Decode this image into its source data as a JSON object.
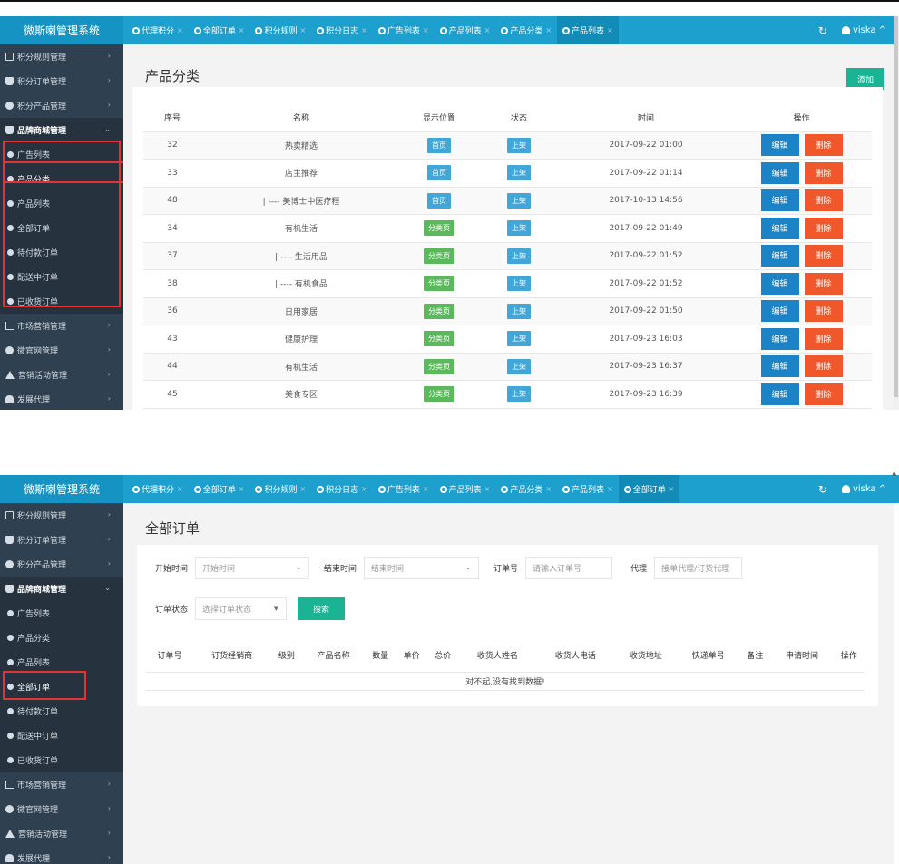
{
  "app_title": "微斯喇管理系统",
  "user": "viska",
  "shot1": {
    "tabs": [
      "代理积分",
      "全部订单",
      "积分规则",
      "积分日志",
      "广告列表",
      "产品列表",
      "产品分类",
      "产品列表"
    ],
    "sidebar": [
      {
        "label": "积分规则管理",
        "icon": "id-card-icon",
        "arrow": "›"
      },
      {
        "label": "积分订单管理",
        "icon": "book-icon",
        "arrow": "›"
      },
      {
        "label": "积分产品管理",
        "icon": "gift-icon",
        "arrow": "›"
      },
      {
        "label": "品牌商城管理",
        "icon": "shopping-bag-icon",
        "arrow": "⌄"
      },
      {
        "label": "广告列表",
        "icon": "circle-icon"
      },
      {
        "label": "产品分类",
        "icon": "circle-icon"
      },
      {
        "label": "产品列表",
        "icon": "circle-icon"
      },
      {
        "label": "全部订单",
        "icon": "circle-icon"
      },
      {
        "label": "待付款订单",
        "icon": "circle-icon"
      },
      {
        "label": "配送中订单",
        "icon": "circle-icon"
      },
      {
        "label": "已收货订单",
        "icon": "circle-icon"
      },
      {
        "label": "市场营销管理",
        "icon": "line-chart-icon",
        "arrow": "›"
      },
      {
        "label": "微官网管理",
        "icon": "globe-icon",
        "arrow": "›"
      },
      {
        "label": "营销活动管理",
        "icon": "bullhorn-icon",
        "arrow": "›"
      },
      {
        "label": "发展代理",
        "icon": "users-icon",
        "arrow": "›"
      }
    ],
    "page_title": "产品分类",
    "add_label": "添加",
    "columns": [
      "序号",
      "名称",
      "显示位置",
      "状态",
      "时间",
      "操作"
    ],
    "rows": [
      {
        "id": "32",
        "name": "热卖精选",
        "pos": "首页",
        "status": "上架",
        "time": "2017-09-22 01:00"
      },
      {
        "id": "33",
        "name": "店主推荐",
        "pos": "首页",
        "status": "上架",
        "time": "2017-09-22 01:14"
      },
      {
        "id": "48",
        "name": "| ---- 美博士中医疗程",
        "pos": "首页",
        "status": "上架",
        "time": "2017-10-13 14:56"
      },
      {
        "id": "34",
        "name": "有机生活",
        "pos": "分类页",
        "status": "上架",
        "time": "2017-09-22 01:49"
      },
      {
        "id": "37",
        "name": "| ---- 生活用品",
        "pos": "分类页",
        "status": "上架",
        "time": "2017-09-22 01:52"
      },
      {
        "id": "38",
        "name": "| ---- 有机食品",
        "pos": "分类页",
        "status": "上架",
        "time": "2017-09-22 01:52"
      },
      {
        "id": "36",
        "name": "日用家居",
        "pos": "分类页",
        "status": "上架",
        "time": "2017-09-22 01:50"
      },
      {
        "id": "43",
        "name": "健康护理",
        "pos": "分类页",
        "status": "上架",
        "time": "2017-09-23 16:03"
      },
      {
        "id": "44",
        "name": "有机生活",
        "pos": "分类页",
        "status": "上架",
        "time": "2017-09-23 16:37"
      },
      {
        "id": "45",
        "name": "美食专区",
        "pos": "分类页",
        "status": "上架",
        "time": "2017-09-23 16:39"
      }
    ],
    "edit_label": "编辑",
    "delete_label": "删除"
  },
  "shot2": {
    "tabs": [
      "代理积分",
      "全部订单",
      "积分规则",
      "积分日志",
      "广告列表",
      "产品列表",
      "产品分类",
      "产品列表",
      "全部订单"
    ],
    "sidebar": [
      {
        "label": "积分规则管理",
        "icon": "id-card-icon",
        "arrow": "›"
      },
      {
        "label": "积分订单管理",
        "icon": "book-icon",
        "arrow": "›"
      },
      {
        "label": "积分产品管理",
        "icon": "gift-icon",
        "arrow": "›"
      },
      {
        "label": "品牌商城管理",
        "icon": "shopping-bag-icon",
        "arrow": "⌄"
      },
      {
        "label": "广告列表",
        "icon": "circle-icon"
      },
      {
        "label": "产品分类",
        "icon": "circle-icon"
      },
      {
        "label": "产品列表",
        "icon": "circle-icon"
      },
      {
        "label": "全部订单",
        "icon": "circle-icon"
      },
      {
        "label": "待付款订单",
        "icon": "circle-icon"
      },
      {
        "label": "配送中订单",
        "icon": "circle-icon"
      },
      {
        "label": "已收货订单",
        "icon": "circle-icon"
      },
      {
        "label": "市场营销管理",
        "icon": "line-chart-icon",
        "arrow": "›"
      },
      {
        "label": "微官网管理",
        "icon": "globe-icon",
        "arrow": "›"
      },
      {
        "label": "营销活动管理",
        "icon": "bullhorn-icon",
        "arrow": "›"
      },
      {
        "label": "发展代理",
        "icon": "users-icon",
        "arrow": "›"
      }
    ],
    "page_title": "全部订单",
    "form": {
      "start_label": "开始时间",
      "start_placeholder": "开始时间",
      "end_label": "结束时间",
      "end_placeholder": "结束时间",
      "order_label": "订单号",
      "order_placeholder": "请输入订单号",
      "agent_label": "代理",
      "agent_placeholder": "接单代理/订货代理",
      "status_label": "订单状态",
      "status_placeholder": "选择订单状态",
      "search_label": "搜索"
    },
    "columns": [
      "订单号",
      "订货经销商",
      "级别",
      "产品名称",
      "数量",
      "单价",
      "总价",
      "收货人姓名",
      "收货人电话",
      "收货地址",
      "快递单号",
      "备注",
      "申请时间",
      "操作"
    ],
    "empty_message": "对不起,没有找到数据!"
  },
  "colors": {
    "nav": "#1ea0cf",
    "sidebar": "#2f4050",
    "primary": "#1ab394",
    "edit": "#1c84c6",
    "delete": "#f0572b",
    "highlight": "#e53333"
  }
}
